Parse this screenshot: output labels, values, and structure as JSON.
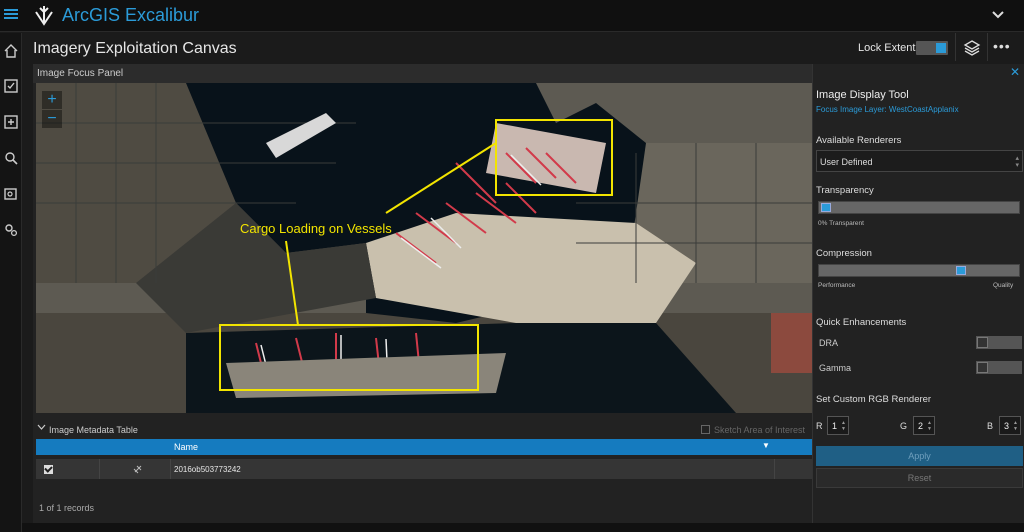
{
  "app": {
    "title": "ArcGIS Excalibur"
  },
  "page": {
    "title": "Imagery Exploitation Canvas"
  },
  "header": {
    "lock_label": "Lock Extents",
    "lock_enabled": true
  },
  "sidebar": {
    "icons": [
      "home-icon",
      "checklist-icon",
      "add-icon",
      "search-icon",
      "images-icon",
      "settings-icon"
    ]
  },
  "focus_panel": {
    "title": "Image Focus Panel",
    "zoom_in": "+",
    "zoom_out": "−",
    "annotation": "Cargo Loading on Vessels"
  },
  "metadata_table": {
    "title": "Image Metadata Table",
    "sketch_label": "Sketch Area of Interest",
    "column_name": "Name",
    "rows": [
      {
        "name": "2016ob503773242",
        "checked": true
      }
    ],
    "records": "1 of 1 records"
  },
  "tool": {
    "title": "Image Display Tool",
    "focus_layer": "Focus Image Layer: WestCoastApplanix",
    "renderers_label": "Available Renderers",
    "renderer_value": "User Defined",
    "transparency_label": "Transparency",
    "transparency_value": "0% Transparent",
    "transparency_percent": 0,
    "compression_label": "Compression",
    "compression_min": "Performance",
    "compression_max": "Quality",
    "compression_level": 0.72,
    "enhancements_label": "Quick Enhancements",
    "dra_label": "DRA",
    "dra_on": false,
    "gamma_label": "Gamma",
    "gamma_on": false,
    "rgb_label": "Set Custom RGB Renderer",
    "r_label": "R",
    "r_value": "1",
    "g_label": "G",
    "g_value": "2",
    "b_label": "B",
    "b_value": "3",
    "apply_label": "Apply",
    "reset_label": "Reset"
  },
  "colors": {
    "accent": "#2b9bd8",
    "annotation": "#f2e400",
    "header_bar": "#157bbf"
  }
}
